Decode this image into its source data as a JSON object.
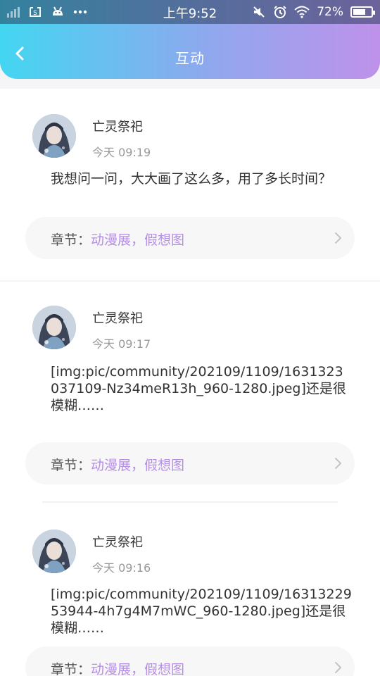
{
  "status_bar": {
    "time": "上午9:52",
    "battery": "72%",
    "battery_level": 0.72
  },
  "header": {
    "title": "互动",
    "accent_gradient": [
      "#43d6f1",
      "#8fa8ee",
      "#bf92ea"
    ]
  },
  "comments": [
    {
      "username": "亡灵祭祀",
      "time": "今天 09:19",
      "text": "我想问一问，大大画了这么多，用了多长时间？",
      "chapter_prefix": "章节：",
      "chapter_name": "动漫展，假想图"
    },
    {
      "username": "亡灵祭祀",
      "time": "今天 09:17",
      "text": "[img:pic/community/202109/1109/1631323037109-Nz34meR13h_960-1280.jpeg]还是很模糊……",
      "chapter_prefix": "章节：",
      "chapter_name": "动漫展，假想图"
    },
    {
      "username": "亡灵祭祀",
      "time": "今天 09:16",
      "text": "[img:pic/community/202109/1109/1631322953944-4h7g4M7mWC_960-1280.jpeg]还是很模糊……",
      "chapter_prefix": "章节：",
      "chapter_name": "动漫展，假想图"
    }
  ],
  "colors": {
    "chapter_link": "#b68de6",
    "background": "#f5f5f7"
  }
}
